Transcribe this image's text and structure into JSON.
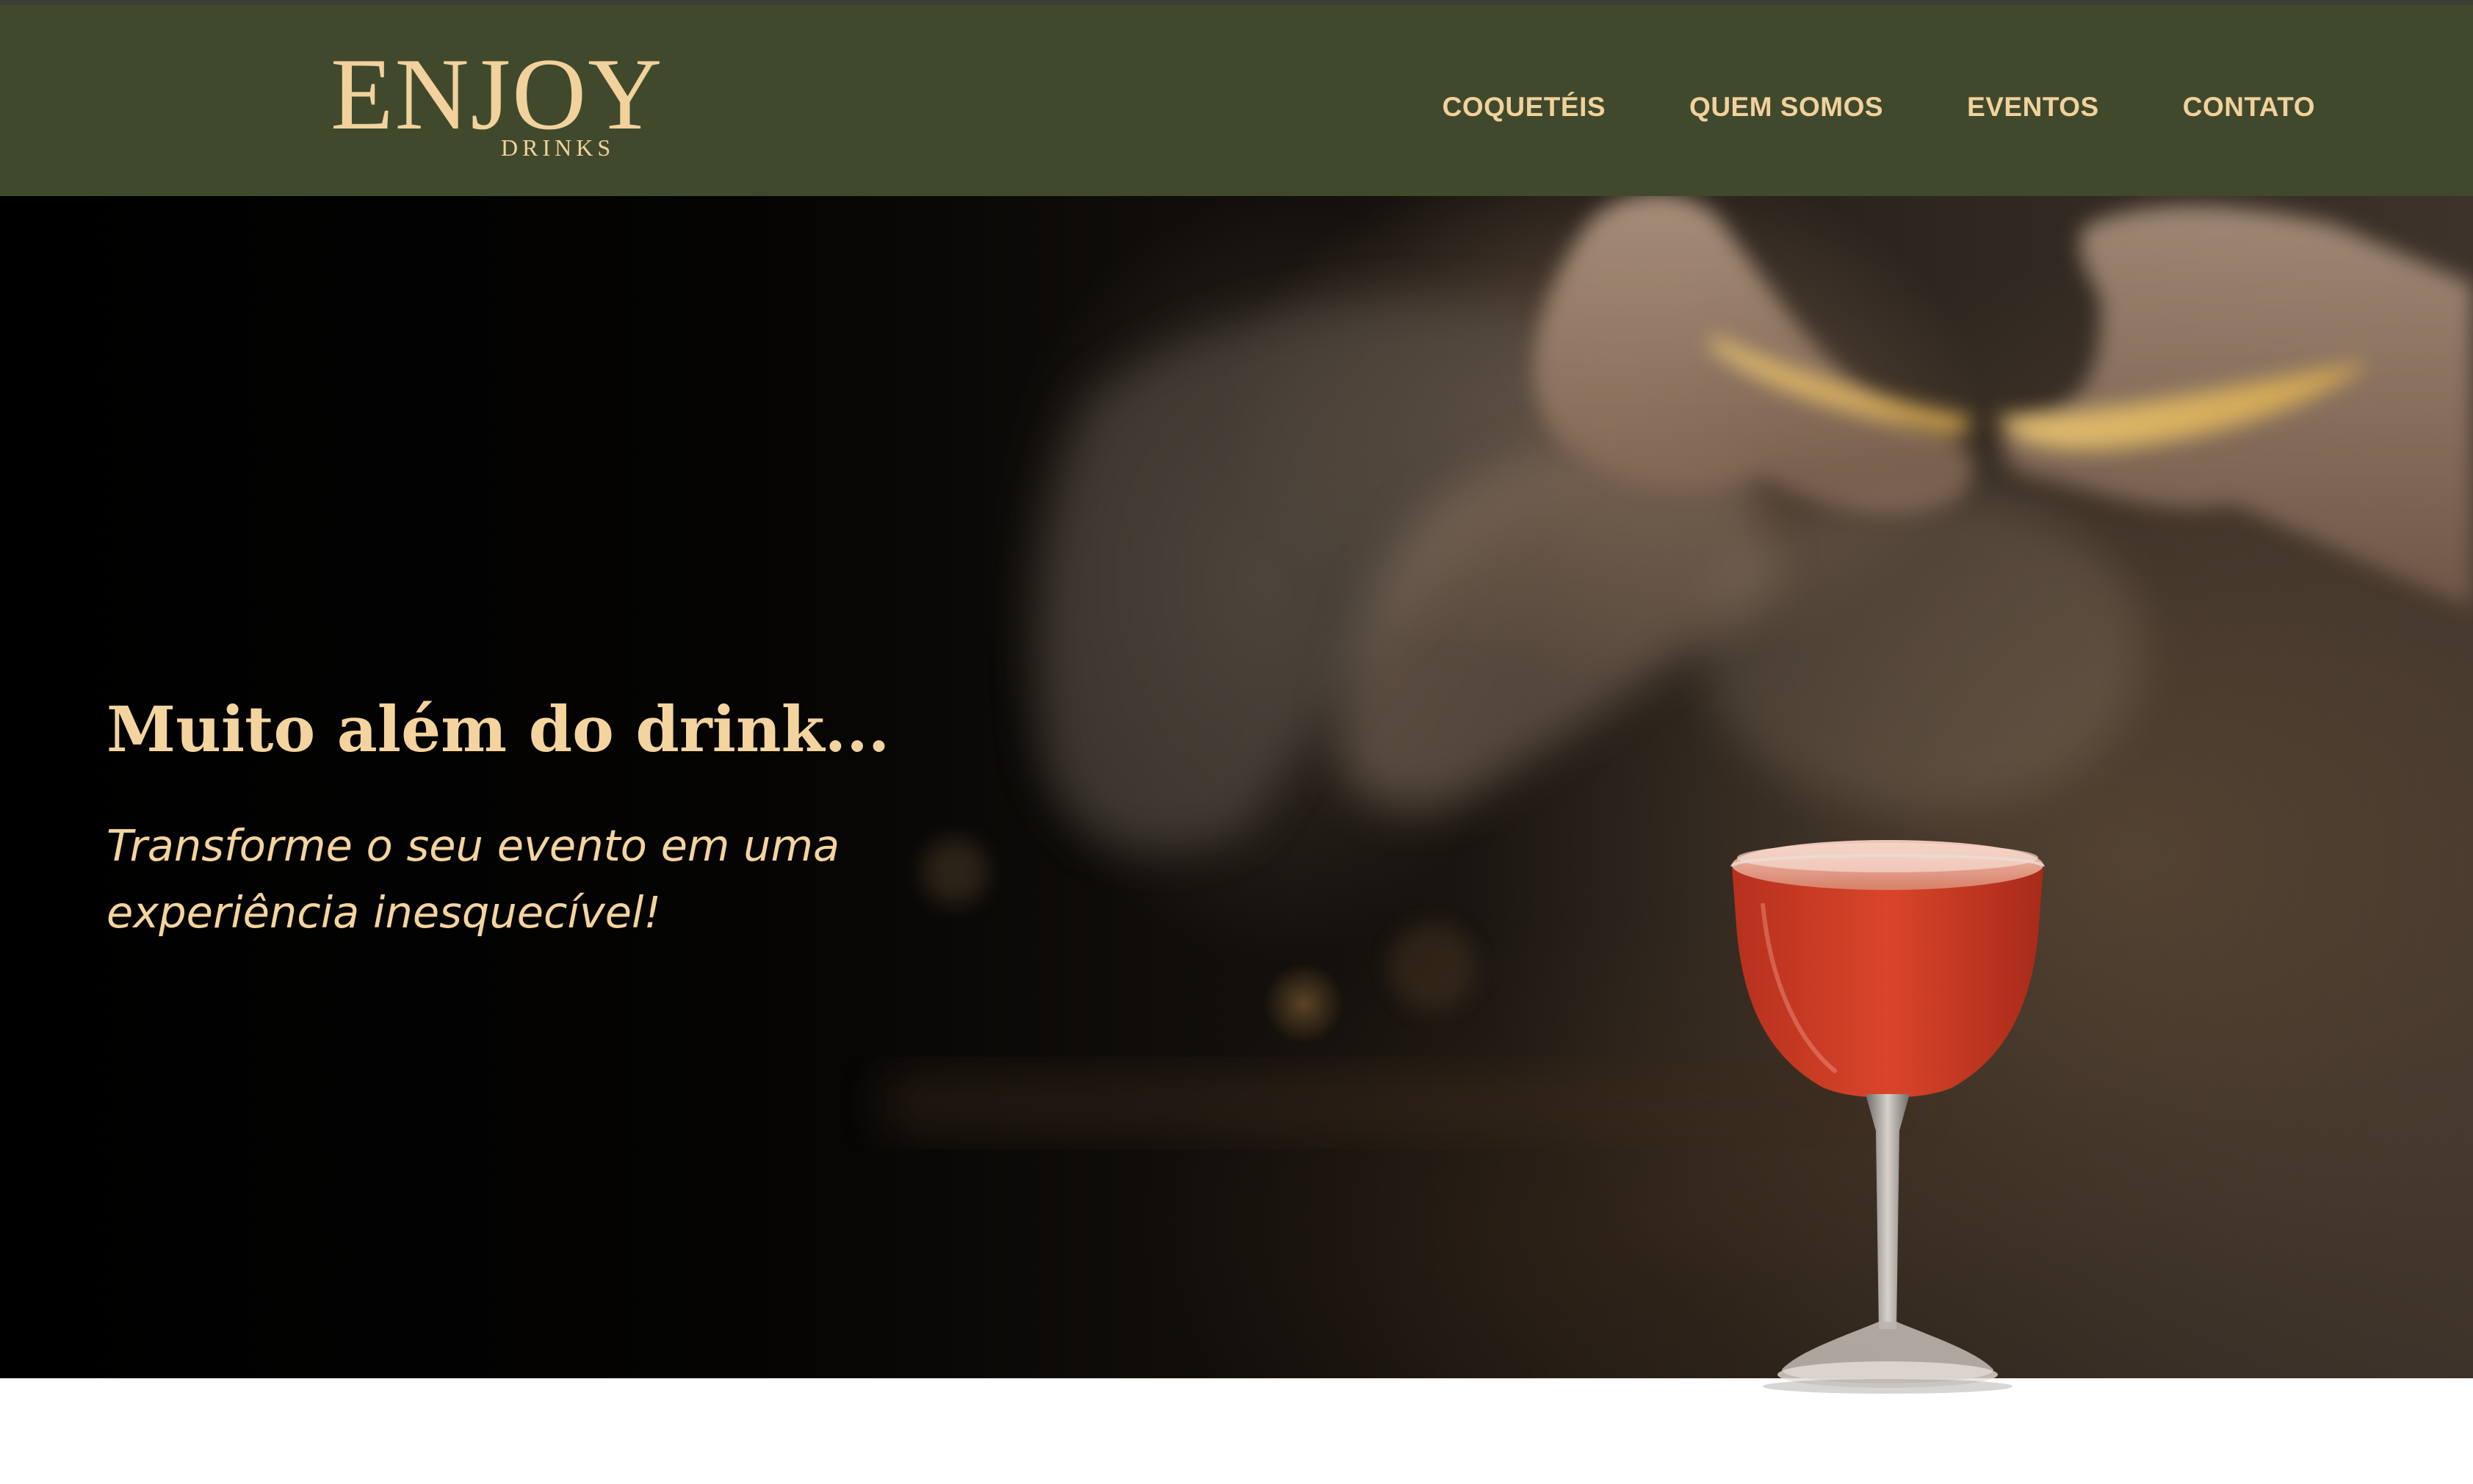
{
  "brand": {
    "logo_main": "ENJOY",
    "logo_sub": "DRINKS"
  },
  "nav": {
    "items": [
      {
        "label": "COQUETÉIS"
      },
      {
        "label": "QUEM SOMOS"
      },
      {
        "label": "EVENTOS"
      },
      {
        "label": "CONTATO"
      }
    ]
  },
  "hero": {
    "title": "Muito além do drink...",
    "subtitle": "Transforme o seu evento em uma experiência inesquecível!"
  },
  "colors": {
    "navbar": "#41492d",
    "accent_gold": "#f1d29c",
    "hero_background": "#000000",
    "cocktail_red": "#c93a26"
  }
}
